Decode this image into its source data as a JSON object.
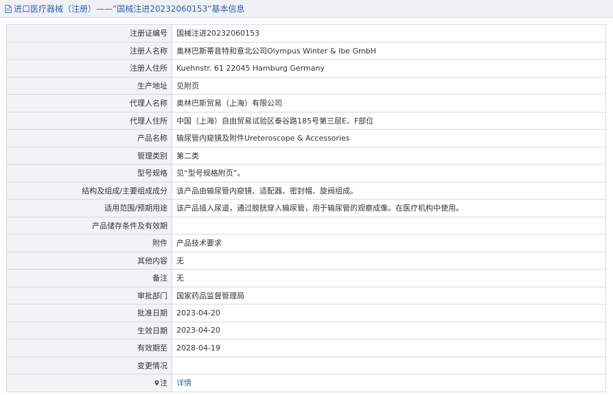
{
  "header": {
    "title": "进口医疗器械（注册）——“国械注进20232060153”基本信息"
  },
  "rows": [
    {
      "label": "注册证编号",
      "value": "国械注进20232060153"
    },
    {
      "label": "注册人名称",
      "value": "奥林巴斯蒂音特和意北公司Olympus Winter & Ibe GmbH"
    },
    {
      "label": "注册人住所",
      "value": "Kuehnstr. 61 22045 Hamburg Germany"
    },
    {
      "label": "生产地址",
      "value": "见附页"
    },
    {
      "label": "代理人名称",
      "value": "奥林巴斯贸易（上海）有限公司"
    },
    {
      "label": "代理人住所",
      "value": "中国（上海）自由贸易试验区泰谷路185号第三层E、F部位"
    },
    {
      "label": "产品名称",
      "value": "输尿管内窥镜及附件Ureteroscope & Accessories"
    },
    {
      "label": "管理类别",
      "value": "第二类"
    },
    {
      "label": "型号规格",
      "value": "见“型号规格附页”。"
    },
    {
      "label": "结构及组成/主要组成成分",
      "value": "该产品由输尿管内窥镜、适配器、密封帽、旋阀组成。"
    },
    {
      "label": "适用范围/预期用途",
      "value": "该产品插入尿道，通过膀胱穿入输尿管，用于输尿管的观察成像。在医疗机构中使用。"
    },
    {
      "label": "产品储存条件及有效期",
      "value": ""
    },
    {
      "label": "附件",
      "value": "产品技术要求"
    },
    {
      "label": "其他内容",
      "value": "无"
    },
    {
      "label": "备注",
      "value": "无"
    },
    {
      "label": "审批部门",
      "value": "国家药品监督管理局"
    },
    {
      "label": "批准日期",
      "value": "2023-04-20"
    },
    {
      "label": "生效日期",
      "value": "2023-04-20"
    },
    {
      "label": "有效期至",
      "value": "2028-04-19"
    },
    {
      "label": "变更情况",
      "value": ""
    }
  ],
  "note_row": {
    "label": "注",
    "link_text": "详情"
  },
  "colors": {
    "link": "#3a62a6",
    "label_bg": "#f2f3f5",
    "header_bg": "#eef1f6",
    "border": "#d3d8e2"
  }
}
